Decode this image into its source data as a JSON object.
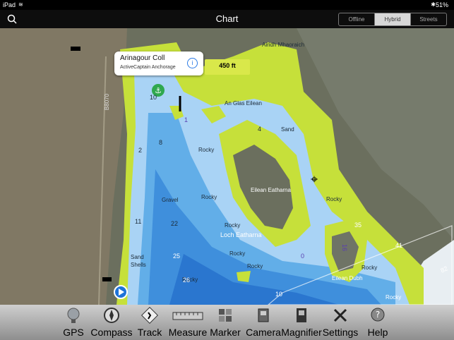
{
  "status": {
    "device": "iPad",
    "battery": "51%"
  },
  "nav": {
    "title": "Chart"
  },
  "segments": [
    "Offline",
    "Hybrid",
    "Streets"
  ],
  "callout": {
    "title": "Arinagour Coll",
    "subtitle": "ActiveCaptain Anchorage",
    "info_icon": "i"
  },
  "scale": {
    "label": "450 ft"
  },
  "places": {
    "airidh": "Airidh Mhaoraich",
    "anglas": "An Glas Eilean",
    "sand1": "Sand",
    "eatharna_island": "Eilean Eatharna",
    "loch": "Loch Eatharna",
    "dubh": "Eilean Dubh",
    "gravel": "Gravel",
    "sandshells1": "Sand",
    "sandshells2": "Shells",
    "road": "B8070"
  },
  "rocky": [
    "Rocky",
    "Rocky",
    "Rocky",
    "Rocky",
    "Rocky",
    "Rocky",
    "Rocky",
    "Rocky",
    "Rocky"
  ],
  "depths": [
    "10",
    "2",
    "8",
    "4",
    "11",
    "22",
    "25",
    "26",
    "10",
    "35",
    "41",
    "1",
    "0",
    "16",
    "82"
  ],
  "tools": [
    "GPS",
    "Compass",
    "Track",
    "Measure",
    "Marker",
    "Camera",
    "Magnifier",
    "Settings",
    "Help"
  ],
  "colors": {
    "land_shallow": "#c6e03a",
    "water_shallow": "#a9d3f5",
    "water_mid": "#62aee8",
    "water_deep": "#2a76cf"
  }
}
